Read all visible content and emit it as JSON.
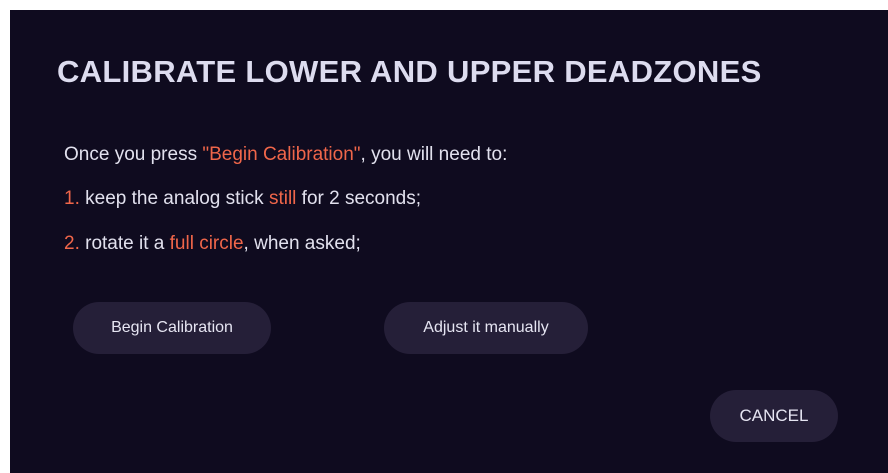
{
  "dialog": {
    "title": "CALIBRATE LOWER AND UPPER DEADZONES",
    "line1": {
      "prefix": "Once you press ",
      "highlight": "\"Begin Calibration\"",
      "suffix": ", you will need to:"
    },
    "line2": {
      "number": "1.",
      "prefix": " keep the analog stick ",
      "highlight": "still",
      "suffix": " for 2 seconds;"
    },
    "line3": {
      "number": "2.",
      "prefix": " rotate it a ",
      "highlight": "full circle",
      "suffix": ", when asked;"
    },
    "buttons": {
      "begin_label": "Begin Calibration",
      "adjust_label": "Adjust it manually",
      "cancel_label": "CANCEL"
    }
  },
  "colors": {
    "background": "#0f0b1f",
    "accent": "#f0664a",
    "button": "#251f38",
    "text": "#e2e1ee"
  }
}
